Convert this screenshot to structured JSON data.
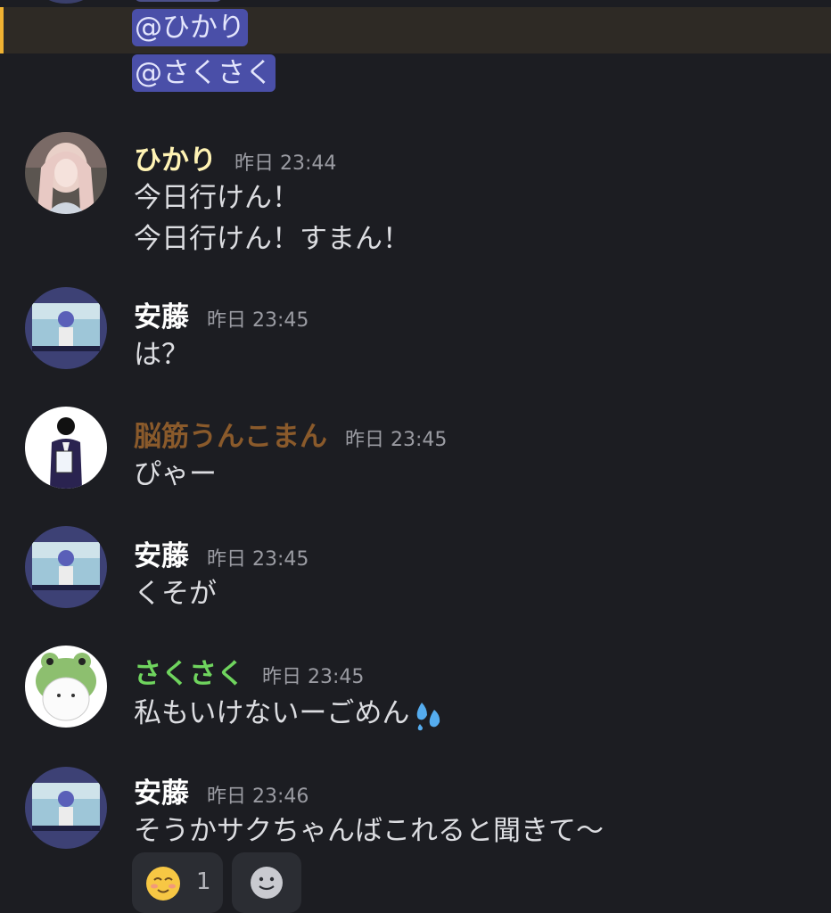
{
  "mentions": [
    "@ひかり",
    "@さくさく"
  ],
  "messages": [
    {
      "author": "ひかり",
      "author_color": "#fff3b4",
      "time": "昨日 23:44",
      "lines": [
        "今日行けん！",
        "今日行けん！すまん！"
      ]
    },
    {
      "author": "安藤",
      "author_color": "#ffffff",
      "time": "昨日 23:45",
      "lines": [
        "は？"
      ]
    },
    {
      "author": "脳筋うんこまん",
      "author_color": "#8a5a2b",
      "time": "昨日 23:45",
      "lines": [
        "ぴゃー"
      ]
    },
    {
      "author": "安藤",
      "author_color": "#ffffff",
      "time": "昨日 23:45",
      "lines": [
        "くそが"
      ]
    },
    {
      "author": "さくさく",
      "author_color": "#6fd45e",
      "time": "昨日 23:45",
      "lines": [
        "私もいけないーごめん"
      ],
      "emoji": "sweat-droplets-icon"
    },
    {
      "author": "安藤",
      "author_color": "#ffffff",
      "time": "昨日 23:46",
      "lines": [
        "そうかサクちゃんばこれると聞きて〜"
      ]
    }
  ],
  "reactions": [
    {
      "emoji": "relieved-face-icon",
      "count": "1"
    },
    {
      "emoji": "add-reaction-icon"
    }
  ]
}
